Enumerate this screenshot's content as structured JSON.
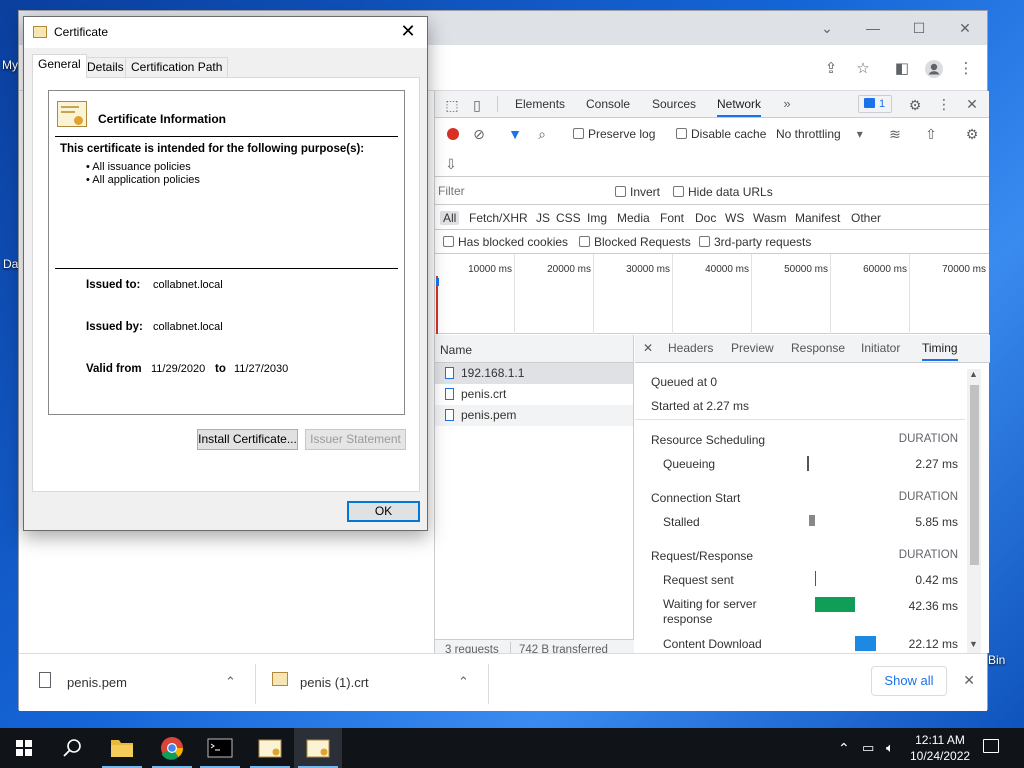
{
  "desktop": {
    "labels": [
      "My",
      "Da",
      "Bin"
    ]
  },
  "chrome": {
    "window_controls": {
      "minimize": "—",
      "maximize": "☐",
      "close": "✕"
    },
    "tab_list_icon": "⌄"
  },
  "devtools": {
    "tabs": [
      "Elements",
      "Console",
      "Sources",
      "Network"
    ],
    "active_tab": "Network",
    "issues_count": "1",
    "toolbar": {
      "preserve_log": "Preserve log",
      "disable_cache": "Disable cache",
      "throttling": "No throttling"
    },
    "filter": {
      "placeholder": "Filter",
      "invert": "Invert",
      "hide_data_urls": "Hide data URLs",
      "types": [
        "All",
        "Fetch/XHR",
        "JS",
        "CSS",
        "Img",
        "Media",
        "Font",
        "Doc",
        "WS",
        "Wasm",
        "Manifest",
        "Other"
      ],
      "has_blocked_cookies": "Has blocked cookies",
      "blocked_requests": "Blocked Requests",
      "third_party": "3rd-party requests"
    },
    "overview_ticks": [
      "10000 ms",
      "20000 ms",
      "30000 ms",
      "40000 ms",
      "50000 ms",
      "60000 ms",
      "70000 ms"
    ],
    "requests": {
      "header": "Name",
      "items": [
        "192.168.1.1",
        "penis.crt",
        "penis.pem"
      ],
      "summary": "3 requests",
      "transferred": "742 B transferred"
    },
    "details": {
      "tabs": [
        "Headers",
        "Preview",
        "Response",
        "Initiator",
        "Timing"
      ],
      "active": "Timing",
      "queued_at": "Queued at 0",
      "started_at": "Started at 2.27 ms",
      "sections": [
        {
          "title": "Resource Scheduling",
          "duration_label": "DURATION",
          "rows": [
            {
              "label": "Queueing",
              "value": "2.27 ms"
            }
          ]
        },
        {
          "title": "Connection Start",
          "duration_label": "DURATION",
          "rows": [
            {
              "label": "Stalled",
              "value": "5.85 ms"
            }
          ]
        },
        {
          "title": "Request/Response",
          "duration_label": "DURATION",
          "rows": [
            {
              "label": "Request sent",
              "value": "0.42 ms"
            },
            {
              "label": "Waiting for server response",
              "value": "42.36 ms"
            },
            {
              "label": "Content Download",
              "value": "22.12 ms"
            }
          ]
        }
      ],
      "colors": {
        "waiting": "#0f9d58",
        "download": "#1e88e5",
        "queue": "#777777"
      }
    }
  },
  "downloads": {
    "items": [
      {
        "name": "penis.pem"
      },
      {
        "name": "penis (1).crt"
      }
    ],
    "show_all": "Show all"
  },
  "certificate": {
    "title": "Certificate",
    "tabs": [
      "General",
      "Details",
      "Certification Path"
    ],
    "heading": "Certificate Information",
    "purpose_intro": "This certificate is intended for the following purpose(s):",
    "purposes": [
      "• All issuance policies",
      "• All application policies"
    ],
    "issued_to_label": "Issued to:",
    "issued_to": "collabnet.local",
    "issued_by_label": "Issued by:",
    "issued_by": "collabnet.local",
    "valid_from_label": "Valid from",
    "valid_from": "11/29/2020",
    "to_label": "to",
    "valid_to": "11/27/2030",
    "install_button": "Install Certificate...",
    "issuer_button": "Issuer Statement",
    "ok_button": "OK"
  },
  "taskbar": {
    "time": "12:11 AM",
    "date": "10/24/2022"
  }
}
